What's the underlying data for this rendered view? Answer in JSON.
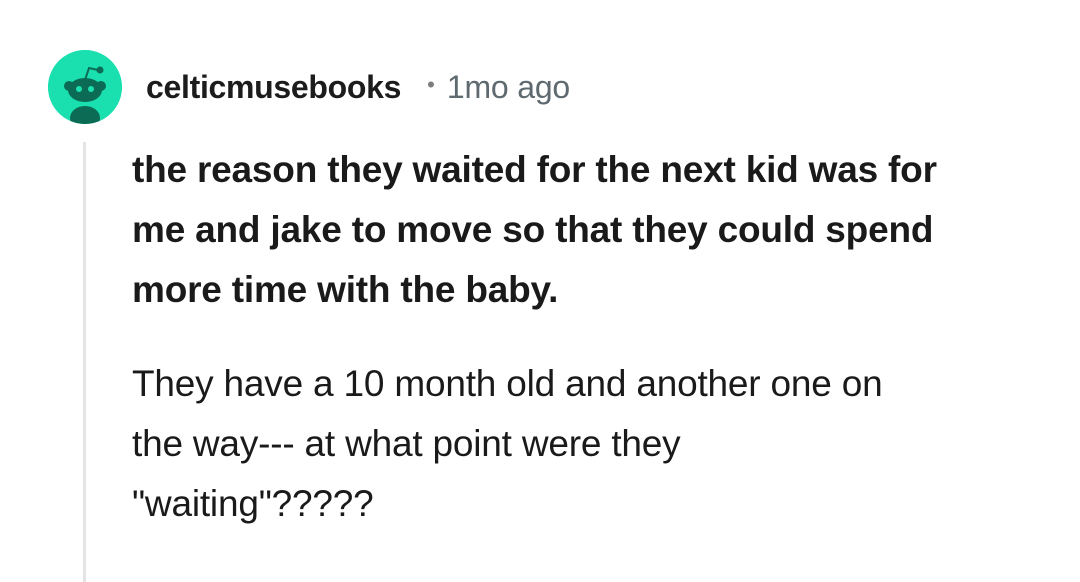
{
  "comment": {
    "author": "celticmusebooks",
    "separator": "•",
    "timestamp": "1mo ago",
    "quote_lines": [
      "the reason they waited for the next kid was for",
      "me and jake to move so that they could spend",
      "more time with the baby."
    ],
    "paragraph_lines": [
      "They have a 10 month old and another one on",
      "the way--- at what point were they",
      "\"waiting\"?????"
    ],
    "avatar_icon": "snoo-avatar-icon"
  },
  "colors": {
    "avatar_bg": "#1ae0b0",
    "text": "#1a1a1a",
    "meta": "#5f6a70",
    "thread_line": "#e4e4e4"
  }
}
